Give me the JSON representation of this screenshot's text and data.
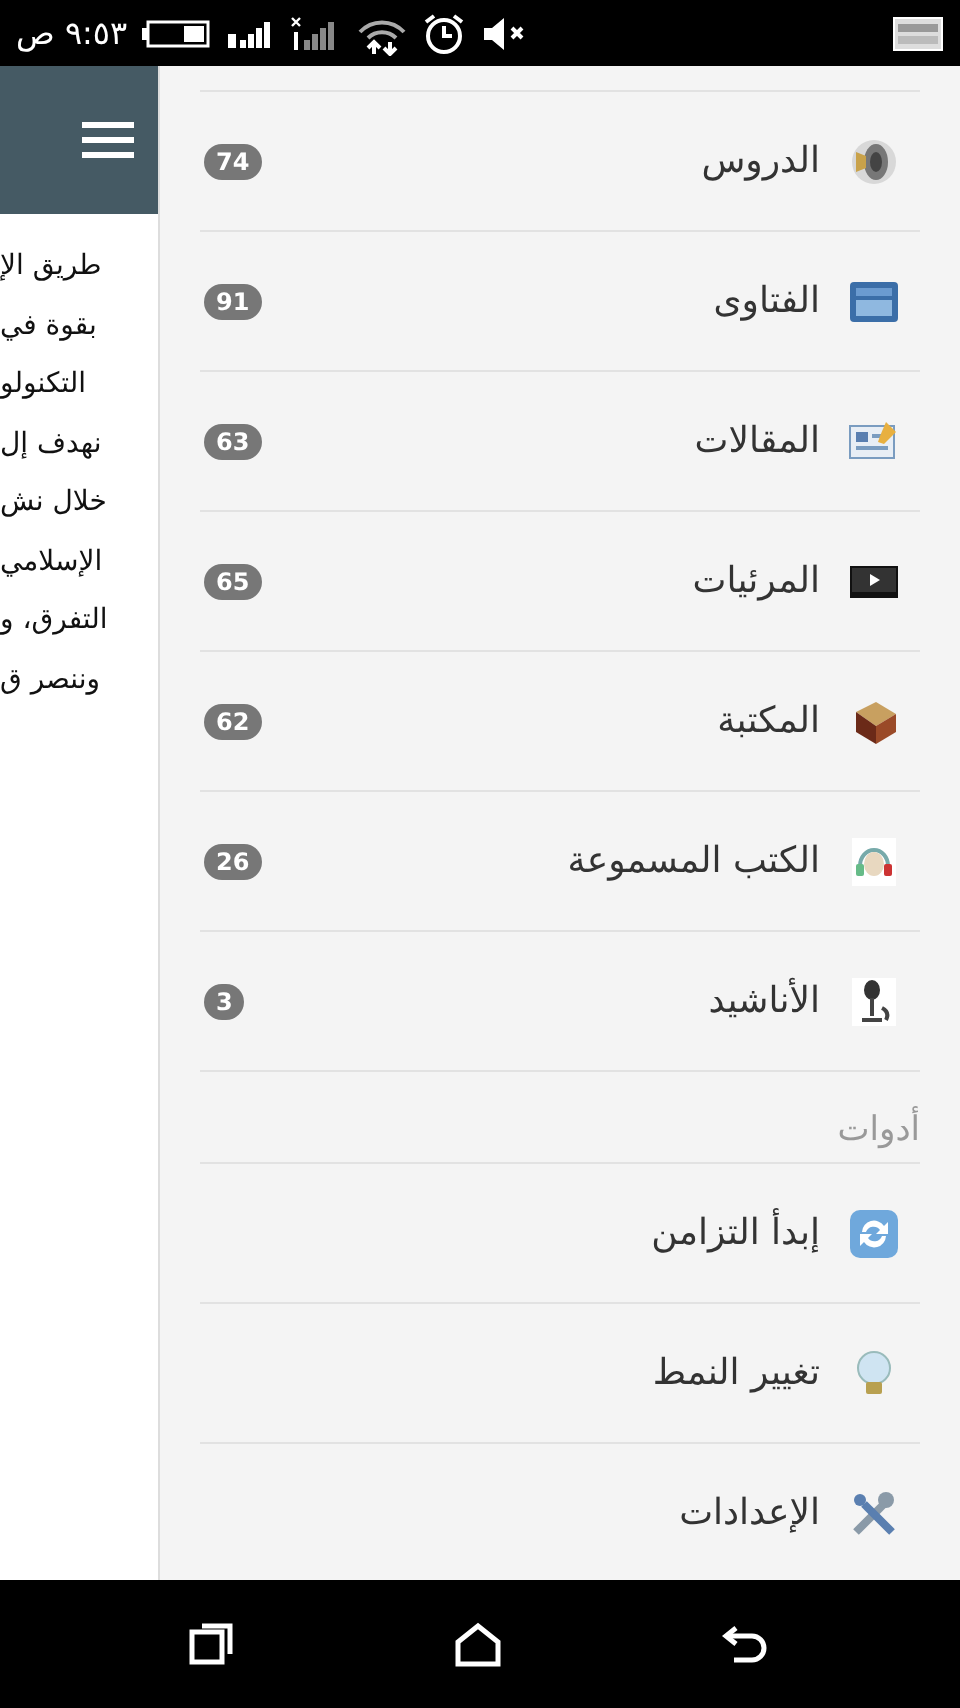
{
  "status_bar": {
    "time": "٩:٥٣ ص"
  },
  "content": {
    "lines": [
      "طريق الإ",
      "بقوة في",
      "التكنولو",
      "نهدف إل",
      "خلال نش",
      "الإسلامي",
      "التفرق، و",
      "وننصر ق"
    ]
  },
  "drawer": {
    "items": [
      {
        "label": "الدروس",
        "count": "74"
      },
      {
        "label": "الفتاوى",
        "count": "91"
      },
      {
        "label": "المقالات",
        "count": "63"
      },
      {
        "label": "المرئيات",
        "count": "65"
      },
      {
        "label": "المكتبة",
        "count": "62"
      },
      {
        "label": "الكتب المسموعة",
        "count": "26"
      },
      {
        "label": "الأناشيد",
        "count": "3"
      }
    ],
    "section_title": "أدوات",
    "tools": [
      {
        "label": "إبدأ التزامن"
      },
      {
        "label": "تغيير النمط"
      },
      {
        "label": "الإعدادات"
      }
    ]
  }
}
